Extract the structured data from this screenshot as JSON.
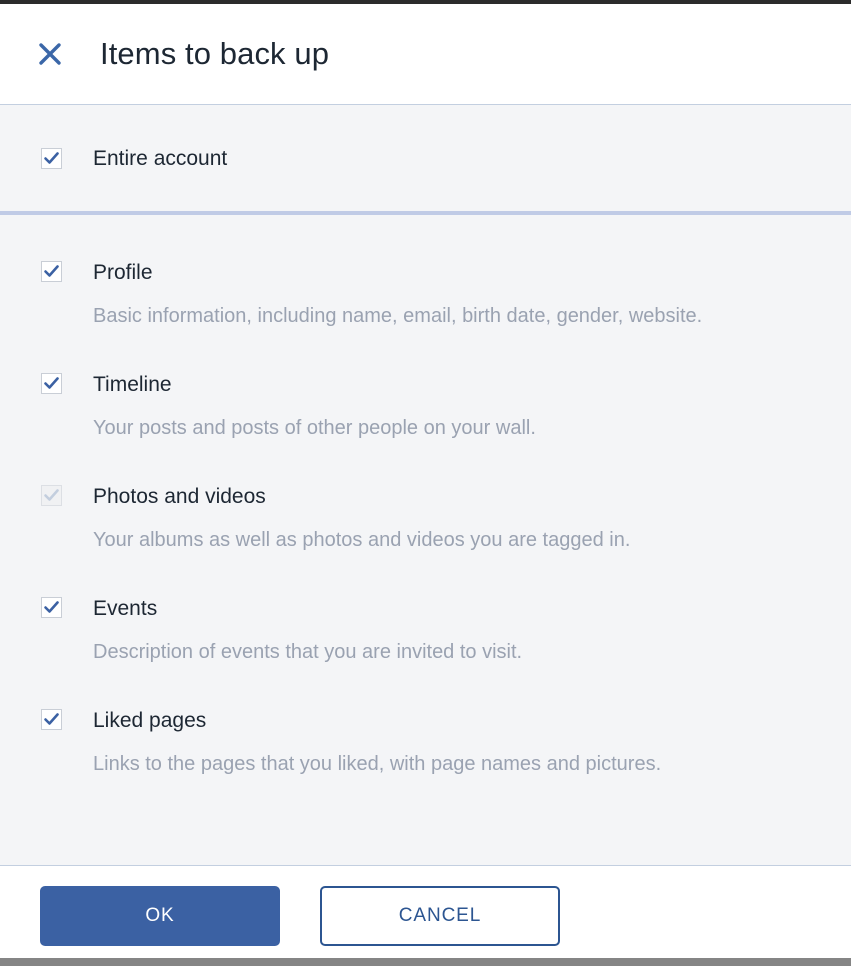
{
  "dialog": {
    "title": "Items to back up",
    "close_icon": "close-icon"
  },
  "root_item": {
    "label": "Entire account",
    "checked": true
  },
  "items": [
    {
      "label": "Profile",
      "description": "Basic information, including name, email, birth date, gender, website.",
      "checked": true,
      "enabled": true
    },
    {
      "label": "Timeline",
      "description": "Your posts and posts of other people on your wall.",
      "checked": true,
      "enabled": true
    },
    {
      "label": "Photos and videos",
      "description": "Your albums as well as photos and videos you are tagged in.",
      "checked": true,
      "enabled": false
    },
    {
      "label": "Events",
      "description": "Description of events that you are invited to visit.",
      "checked": true,
      "enabled": true
    },
    {
      "label": "Liked pages",
      "description": "Links to the pages that you liked, with page names and pictures.",
      "checked": true,
      "enabled": true
    }
  ],
  "footer": {
    "ok_label": "OK",
    "cancel_label": "CANCEL"
  },
  "colors": {
    "accent_blue": "#3b61a3",
    "check_blue": "#3b61a3",
    "check_blue_disabled": "#c3cede",
    "title_text": "#1d2733",
    "description_text": "#9aa2b1",
    "body_background": "#f4f5f7",
    "divider": "#c0cbe6",
    "cancel_border": "#2c5591"
  }
}
